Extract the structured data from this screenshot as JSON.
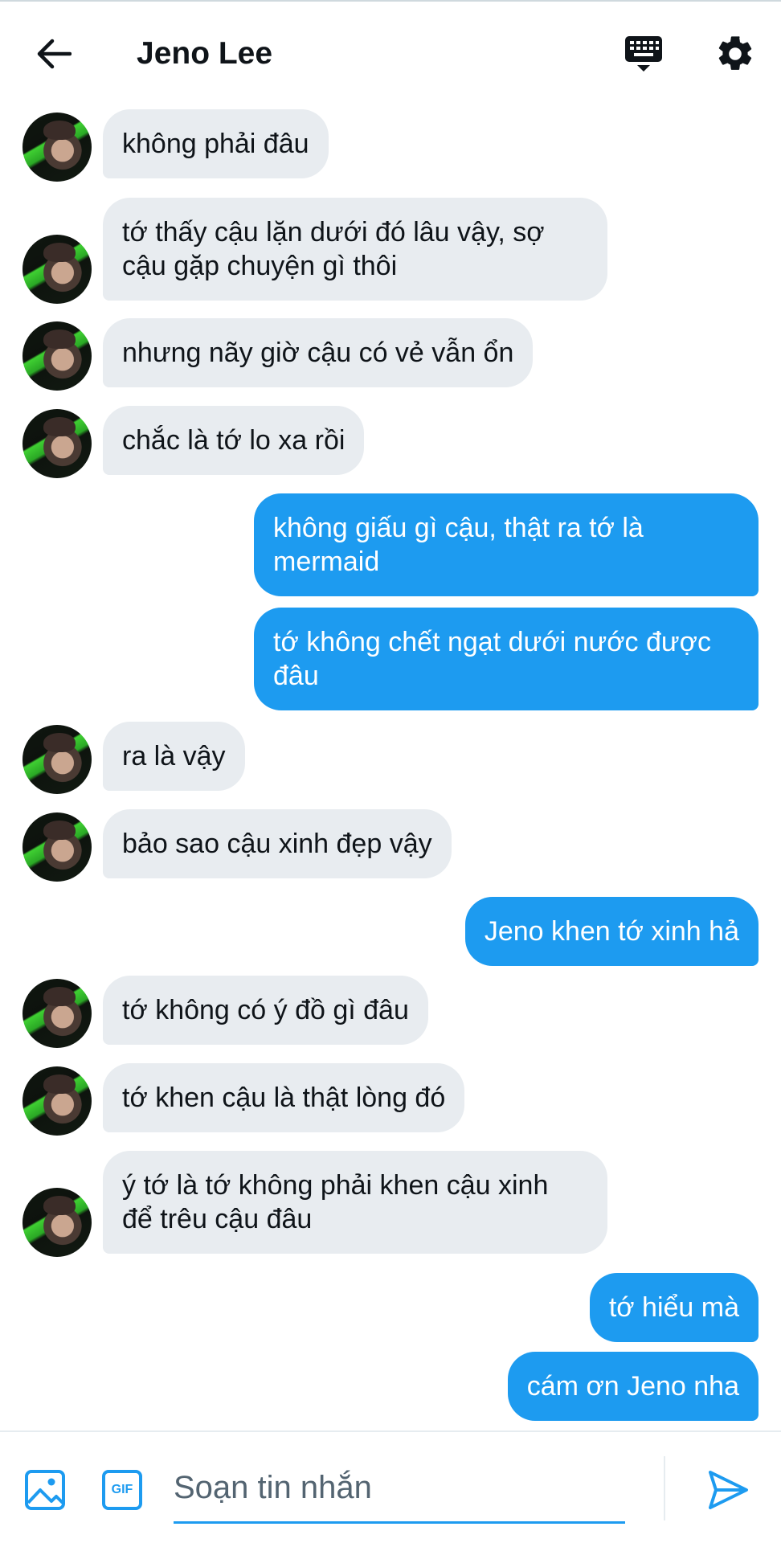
{
  "header": {
    "title": "Jeno Lee",
    "icons": {
      "back": "arrow-left-icon",
      "keyboard": "keyboard-icon",
      "settings": "gear-icon"
    }
  },
  "messages": [
    {
      "dir": "in",
      "text": "không phải đâu",
      "avatar": true
    },
    {
      "dir": "in",
      "text": "tớ thấy cậu lặn dưới đó lâu vậy, sợ\ncậu gặp chuyện gì thôi",
      "avatar": true
    },
    {
      "dir": "in",
      "text": "nhưng nãy giờ cậu có vẻ vẫn ổn",
      "avatar": true
    },
    {
      "dir": "in",
      "text": "chắc là tớ lo xa rồi",
      "avatar": true
    },
    {
      "dir": "out",
      "text": "không giấu gì cậu, thật ra tớ là\nmermaid"
    },
    {
      "dir": "out",
      "text": "tớ không chết ngạt dưới nước được\nđâu"
    },
    {
      "dir": "in",
      "text": "ra là vậy",
      "avatar": true
    },
    {
      "dir": "in",
      "text": "bảo sao cậu xinh đẹp vậy",
      "avatar": true
    },
    {
      "dir": "out",
      "text": "Jeno khen tớ xinh hả"
    },
    {
      "dir": "in",
      "text": "tớ không có ý đồ gì đâu",
      "avatar": true
    },
    {
      "dir": "in",
      "text": "tớ khen cậu là thật lòng đó",
      "avatar": true
    },
    {
      "dir": "in",
      "text": "ý tớ là tớ không phải khen cậu xinh\nđể trêu cậu đâu",
      "avatar": true
    },
    {
      "dir": "out",
      "text": "tớ hiểu mà"
    },
    {
      "dir": "out",
      "text": "cám ơn Jeno nha"
    }
  ],
  "composer": {
    "placeholder": "Soạn tin nhắn",
    "gif_label": "GIF",
    "icons": {
      "image": "image-icon",
      "gif": "gif-icon",
      "send": "send-icon"
    }
  },
  "colors": {
    "accent": "#1d9bf0",
    "incoming_bubble": "#e8ecf0",
    "text": "#0f1419"
  }
}
